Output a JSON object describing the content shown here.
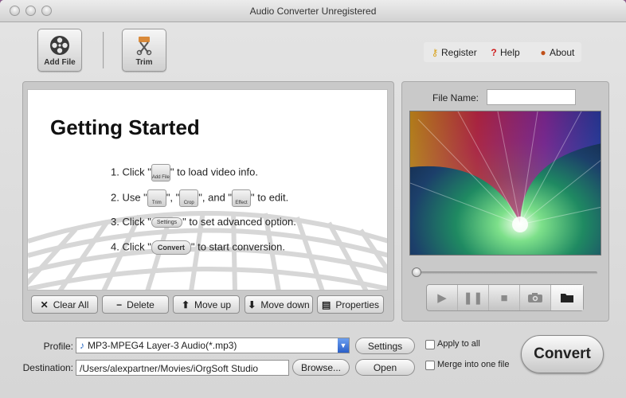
{
  "window": {
    "title": "Audio Converter Unregistered"
  },
  "toolbar": {
    "add_file": "Add File",
    "trim": "Trim"
  },
  "toplinks": {
    "register": "Register",
    "help": "Help",
    "about": "About"
  },
  "guide": {
    "heading": "Getting Started",
    "step1_prefix": "1. Click \"",
    "step1_icon": "Add File",
    "step1_suffix": "\" to load video info.",
    "step2_prefix": "2. Use \"",
    "step2_icon1": "Trim",
    "step2_sep1": "\", \"",
    "step2_icon2": "Crop",
    "step2_sep2": "\", and \"",
    "step2_icon3": "Effect",
    "step2_suffix": "\" to edit.",
    "step3_prefix": "3. Click \"",
    "step3_icon": "Settings",
    "step3_suffix": "\" to set advanced option.",
    "step4_prefix": "4. Click \"",
    "step4_icon": "Convert",
    "step4_suffix": "\" to start conversion."
  },
  "list_buttons": {
    "clear_all": "Clear All",
    "delete": "Delete",
    "move_up": "Move up",
    "move_down": "Move down",
    "properties": "Properties"
  },
  "preview": {
    "file_name_label": "File Name:",
    "file_name_value": ""
  },
  "playback": {
    "play_icon": "play-icon",
    "pause_icon": "pause-icon",
    "stop_icon": "stop-icon",
    "snapshot_icon": "camera-icon",
    "folder_icon": "folder-icon",
    "position": 0.0
  },
  "bottom": {
    "profile_label": "Profile:",
    "profile_value": "MP3-MPEG4 Layer-3 Audio(*.mp3)",
    "destination_label": "Destination:",
    "destination_value": "/Users/alexpartner/Movies/iOrgSoft Studio",
    "settings": "Settings",
    "browse": "Browse...",
    "open": "Open",
    "apply_to_all": "Apply to all",
    "merge_into_one": "Merge into one file",
    "convert": "Convert"
  },
  "colors": {
    "dropdown_accent": "#2a5fc8",
    "window_bg": "#d9d9d9"
  }
}
